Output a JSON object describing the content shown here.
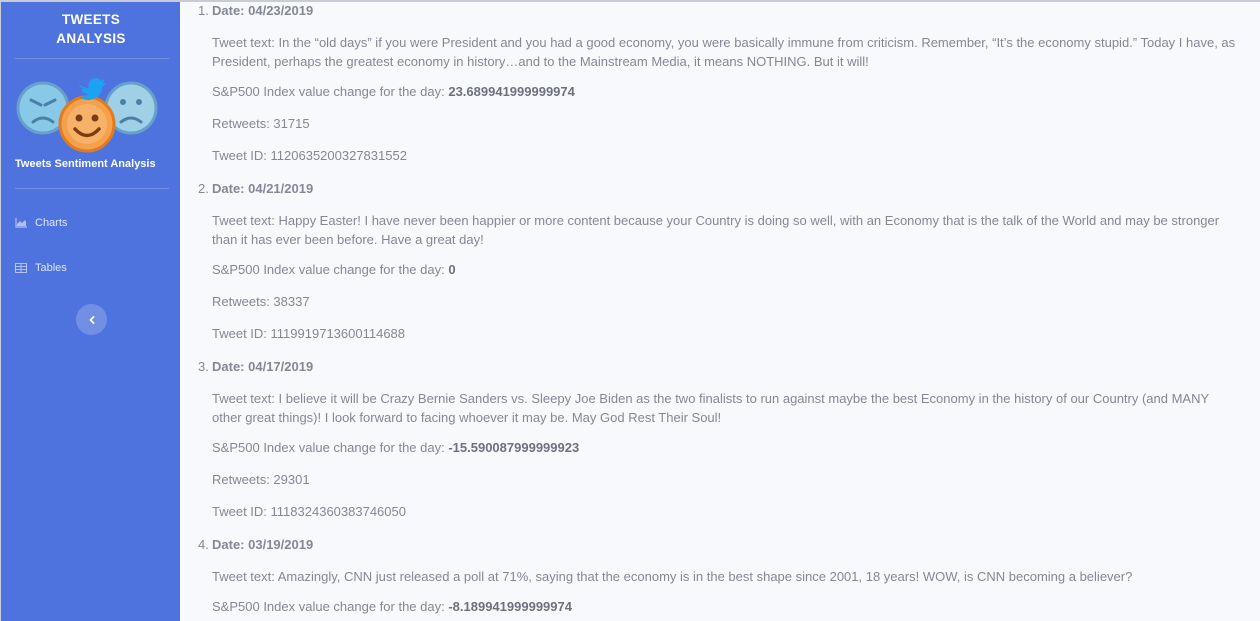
{
  "sidebar": {
    "brand_line1": "TWEETS",
    "brand_line2": "ANALYSIS",
    "logo_caption": "Tweets Sentiment Analysis",
    "nav": [
      {
        "label": "Charts",
        "icon": "chart-area-icon"
      },
      {
        "label": "Tables",
        "icon": "table-icon"
      }
    ],
    "toggle_icon": "chevron-left-icon"
  },
  "labels": {
    "date_prefix": "Date: ",
    "text_prefix": "Tweet text: ",
    "sp_prefix": "S&P500 Index value change for the day: ",
    "retweets_prefix": "Retweets: ",
    "id_prefix": "Tweet ID: "
  },
  "tweets": [
    {
      "num": "1.",
      "date": "04/23/2019",
      "text": "In the “old days” if you were President and you had a good economy, you were basically immune from criticism. Remember, “It’s the economy stupid.” Today I have, as President, perhaps the greatest economy in history…and to the Mainstream Media, it means NOTHING. But it will!",
      "sp_change": "23.689941999999974",
      "retweets": "31715",
      "id": "1120635200327831552"
    },
    {
      "num": "2.",
      "date": "04/21/2019",
      "text": "Happy Easter! I have never been happier or more content because your Country is doing so well, with an Economy that is the talk of the World and may be stronger than it has ever been before. Have a great day!",
      "sp_change": "0",
      "retweets": "38337",
      "id": "1119919713600114688"
    },
    {
      "num": "3.",
      "date": "04/17/2019",
      "text": "I believe it will be Crazy Bernie Sanders vs. Sleepy Joe Biden as the two finalists to run against maybe the best Economy in the history of our Country (and MANY other great things)! I look forward to facing whoever it may be. May God Rest Their Soul!",
      "sp_change": "-15.590087999999923",
      "retweets": "29301",
      "id": "1118324360383746050"
    },
    {
      "num": "4.",
      "date": "03/19/2019",
      "text": "Amazingly, CNN just released a poll at 71%, saying that the economy is in the best shape since 2001, 18 years! WOW, is CNN becoming a believer?",
      "sp_change": "-8.189941999999974",
      "retweets": "",
      "id": ""
    }
  ]
}
